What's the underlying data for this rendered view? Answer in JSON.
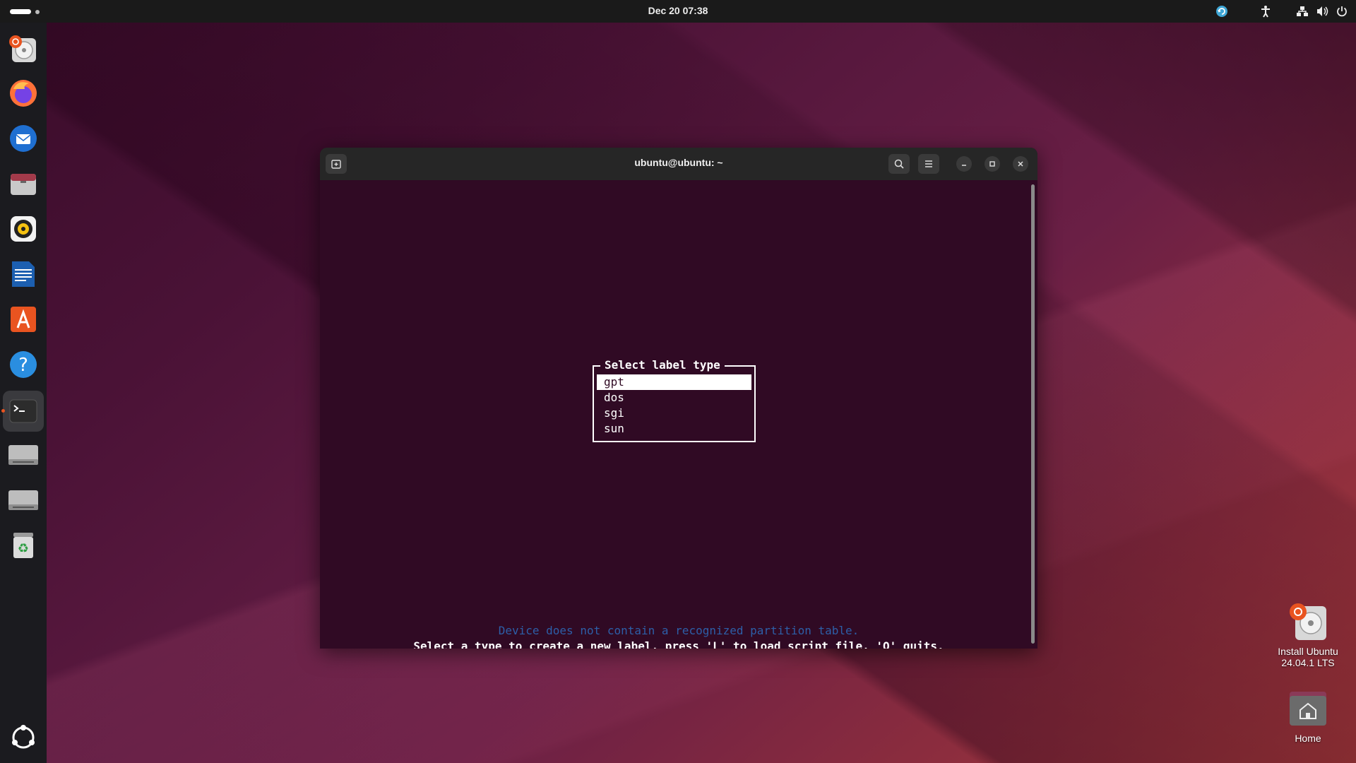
{
  "topbar": {
    "clock": "Dec 20  07:38",
    "tray_icons": [
      "updates-icon",
      "accessibility-icon",
      "network-icon",
      "volume-icon",
      "power-icon"
    ]
  },
  "dock": {
    "items": [
      {
        "name": "install-ubuntu-icon",
        "label": "Install Ubuntu"
      },
      {
        "name": "firefox-icon",
        "label": "Firefox"
      },
      {
        "name": "thunderbird-icon",
        "label": "Thunderbird"
      },
      {
        "name": "files-icon",
        "label": "Files"
      },
      {
        "name": "rhythmbox-icon",
        "label": "Rhythmbox"
      },
      {
        "name": "writer-icon",
        "label": "LibreOffice Writer"
      },
      {
        "name": "app-center-icon",
        "label": "App Center"
      },
      {
        "name": "help-icon",
        "label": "Help"
      },
      {
        "name": "terminal-icon",
        "label": "Terminal",
        "running": true
      },
      {
        "name": "drive-icon",
        "label": "Drive 1"
      },
      {
        "name": "drive-icon",
        "label": "Drive 2"
      },
      {
        "name": "trash-icon",
        "label": "Trash"
      }
    ],
    "show_apps": "show-apps-icon"
  },
  "terminal": {
    "title": "ubuntu@ubuntu: ~",
    "dialog_title": "Select label type",
    "options": [
      "gpt",
      "dos",
      "sgi",
      "sun"
    ],
    "selected": "gpt",
    "message_warning": "Device does not contain a recognized partition table.",
    "message_hint": "Select a type to create a new label, press 'L' to load script file, 'Q' quits.",
    "colors": {
      "background": "#300a24",
      "warning": "#2d5fa8"
    }
  },
  "desktop_icons": [
    {
      "line1": "Install Ubuntu",
      "line2": "24.04.1 LTS"
    },
    {
      "line1": "Home"
    }
  ],
  "colors": {
    "accent": "#e95420"
  }
}
